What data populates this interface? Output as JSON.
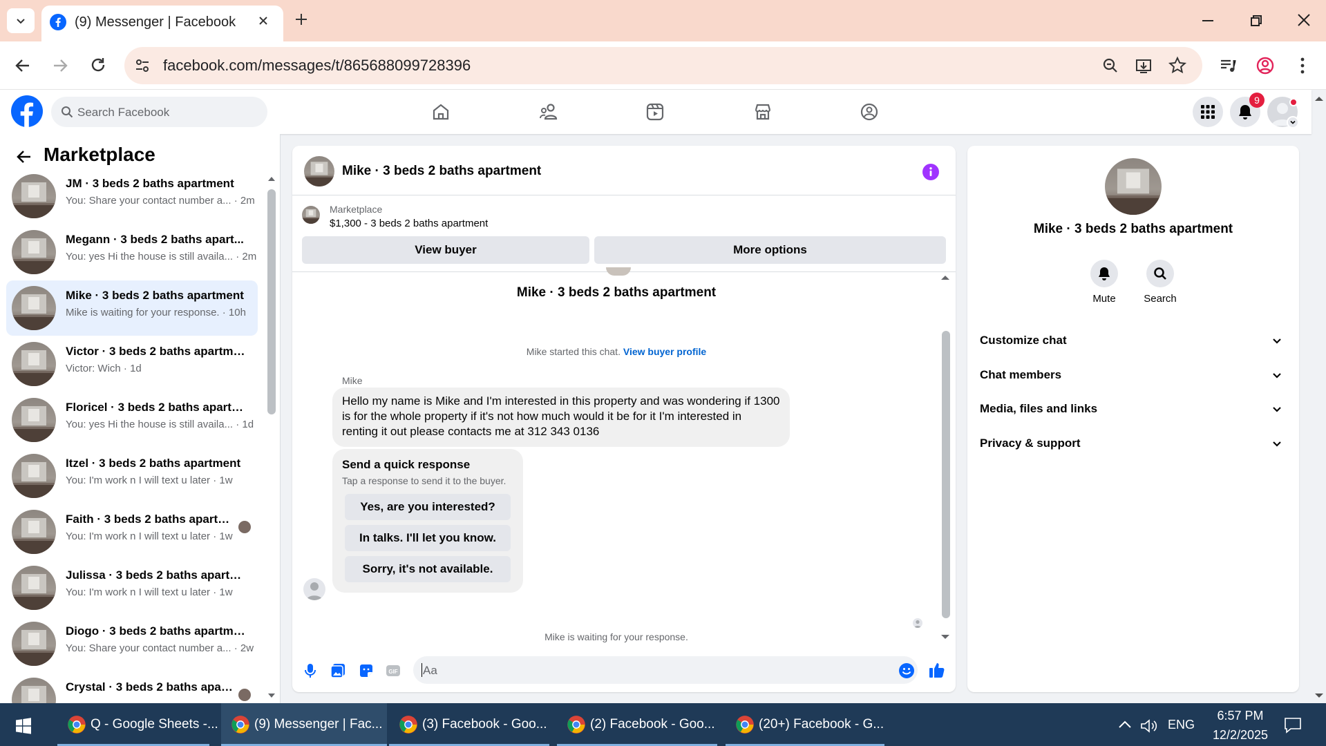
{
  "browser": {
    "tab_title": "(9) Messenger | Facebook",
    "url": "facebook.com/messages/t/865688099728396"
  },
  "fb": {
    "search_placeholder": "Search Facebook",
    "notification_count": "9",
    "brand_color": "#0866ff"
  },
  "sidebar": {
    "title": "Marketplace",
    "conversations": [
      {
        "name": "JM · 3 beds 2 baths apartment",
        "preview": "You: Share your contact number a...",
        "time": "· 2m"
      },
      {
        "name": "Megann · 3 beds 2 baths apart...",
        "preview": "You: yes Hi the house is still availa...",
        "time": "· 2m"
      },
      {
        "name": "Mike · 3 beds 2 baths apartment",
        "preview": "Mike is waiting for your response.",
        "time": "· 10h"
      },
      {
        "name": "Victor · 3 beds 2 baths apartment",
        "preview": "Victor: Wich",
        "time": "· 1d"
      },
      {
        "name": "Floricel · 3 beds 2 baths apartm...",
        "preview": "You: yes Hi the house is still availa...",
        "time": "· 1d"
      },
      {
        "name": "Itzel · 3 beds 2 baths apartment",
        "preview": "You: I'm work n I will text u later",
        "time": "· 1w"
      },
      {
        "name": "Faith · 3 beds 2 baths apartm...",
        "preview": "You: I'm work n I will text u later",
        "time": "· 1w"
      },
      {
        "name": "Julissa · 3 beds 2 baths apartme...",
        "preview": "You: I'm work n I will text u later",
        "time": "· 1w"
      },
      {
        "name": "Diogo · 3 beds 2 baths apartme...",
        "preview": "You: Share your contact number a...",
        "time": "· 2w"
      },
      {
        "name": "Crystal · 3 beds 2 baths apart...",
        "preview": "",
        "time": ""
      }
    ]
  },
  "chat": {
    "title": "Mike · 3 beds 2 baths apartment",
    "marketplace_label": "Marketplace",
    "listing": "$1,300 - 3 beds 2 baths apartment",
    "view_buyer": "View buyer",
    "more_options": "More options",
    "top_name": "Mike · 3 beds 2 baths apartment",
    "started_text": "Mike started this chat.",
    "view_buyer_profile": "View buyer profile",
    "sender": "Mike",
    "message": "Hello my name is Mike and I'm interested in this property and was wondering if 1300 is for the whole property if it's not how much would it be for it I'm interested in renting it out please contacts me at 312 343 0136",
    "quick_title": "Send a quick response",
    "quick_sub": "Tap a response to send it to the buyer.",
    "quick_responses": [
      "Yes, are you interested?",
      "In talks. I'll let you know.",
      "Sorry, it's not available."
    ],
    "waiting": "Mike is waiting for your response.",
    "composer_placeholder": "Aa"
  },
  "info": {
    "name": "Mike · 3 beds 2 baths apartment",
    "mute": "Mute",
    "search": "Search",
    "rows": [
      "Customize chat",
      "Chat members",
      "Media, files and links",
      "Privacy & support"
    ]
  },
  "taskbar": {
    "items": [
      "Q - Google Sheets -...",
      "(9) Messenger | Fac...",
      "(3) Facebook - Goo...",
      "(2) Facebook - Goo...",
      "(20+) Facebook - G..."
    ],
    "lang": "ENG",
    "time": "6:57 PM",
    "date": "12/2/2025"
  }
}
